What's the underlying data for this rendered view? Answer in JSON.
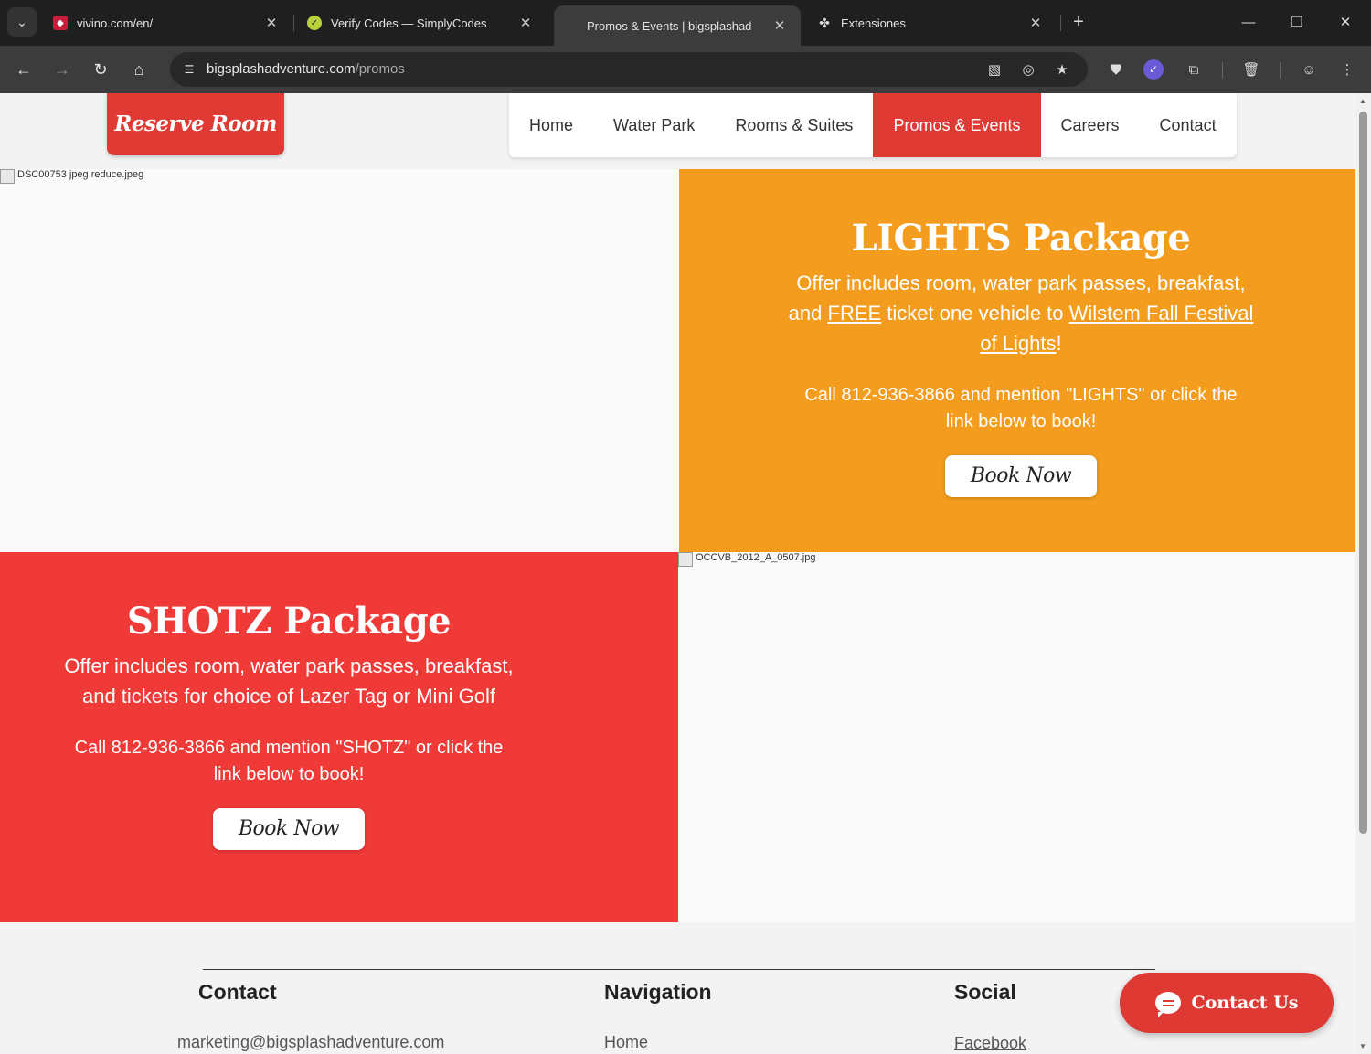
{
  "browser": {
    "tabs": [
      {
        "title": "vivino.com/en/",
        "active": false
      },
      {
        "title": "Verify Codes — SimplyCodes",
        "active": false
      },
      {
        "title": "Promos & Events | bigsplashad",
        "active": true
      },
      {
        "title": "Extensiones",
        "active": false
      }
    ],
    "url_host": "bigsplashadventure.com",
    "url_path": "/promos"
  },
  "header": {
    "reserve_label": "Reserve Room",
    "nav": [
      "Home",
      "Water Park",
      "Rooms & Suites",
      "Promos & Events",
      "Careers",
      "Contact"
    ],
    "active_nav": "Promos & Events"
  },
  "promos": {
    "image1_alt": "DSC00753 jpeg reduce.jpeg",
    "image2_alt": "OCCVB_2012_A_0507.jpg",
    "lights": {
      "title": "LIGHTS Package",
      "desc_part1": "Offer includes room, water park passes, breakfast, and ",
      "desc_link1": "FREE",
      "desc_part2": " ticket one vehicle to ",
      "desc_link2": "Wilstem Fall Festival of Lights",
      "desc_part3": "!",
      "call": "Call 812-936-3866 and mention \"LIGHTS\" or click the link below to book!",
      "button": "Book Now",
      "bg_color": "#f39c1e"
    },
    "shotz": {
      "title": "SHOTZ Package",
      "desc": "Offer includes room, water park passes, breakfast, and tickets for choice of Lazer Tag or Mini Golf",
      "call": "Call 812-936-3866 and mention \"SHOTZ\" or click the link below to book!",
      "button": "Book Now",
      "bg_color": "#ef3a37"
    }
  },
  "footer": {
    "contact_title": "Contact",
    "contact_email": "marketing@bigsplashadventure.com",
    "nav_title": "Navigation",
    "nav_first": "Home",
    "social_title": "Social",
    "social_first": "Facebook",
    "contact_us_button": "Contact Us"
  },
  "colors": {
    "brand_red": "#e03a34",
    "orange": "#f39c1e"
  }
}
